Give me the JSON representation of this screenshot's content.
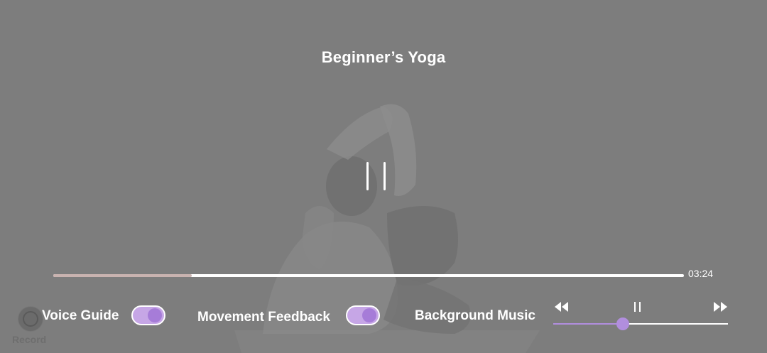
{
  "player": {
    "title": "Beginner’s Yoga",
    "time": "03:24",
    "progress": 0.22
  },
  "controls": {
    "voice_guide": {
      "label": "Voice Guide",
      "on": true
    },
    "movement_feedback": {
      "label": "Movement Feedback",
      "on": true
    },
    "background_music": {
      "label": "Background Music",
      "volume": 0.4
    },
    "record_label": "Record"
  },
  "colors": {
    "overlay": "#7d7d7d",
    "accent": "#b18ede",
    "toggle_track": "#c6a6e6",
    "progress_fill": "#c9b3b0"
  },
  "icons": [
    "pause-icon",
    "rewind-icon",
    "music-pause-icon",
    "fast-forward-icon",
    "record-icon"
  ]
}
